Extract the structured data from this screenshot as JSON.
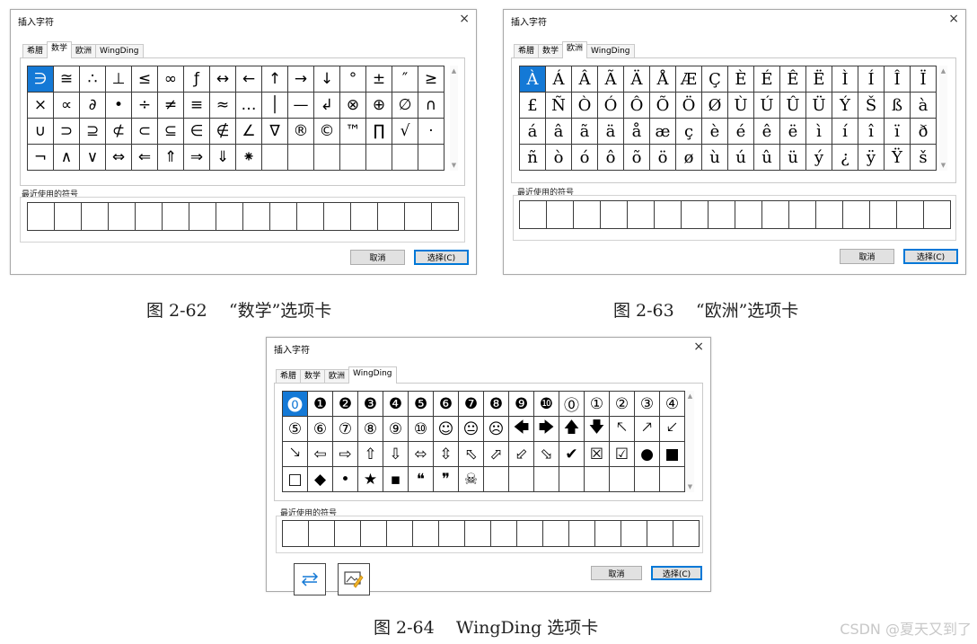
{
  "dialog_title": "插入字符",
  "close_glyph": "×",
  "tabs": [
    "希腊",
    "数学",
    "欧洲",
    "WingDing"
  ],
  "recent_label": "最近使用的符号",
  "cancel_label": "取消",
  "select_label": "选择(C)",
  "math_symbols": [
    "∋",
    "≅",
    "∴",
    "⊥",
    "≤",
    "∞",
    "ƒ",
    "↔",
    "←",
    "↑",
    "→",
    "↓",
    "°",
    "±",
    "″",
    "≥",
    "×",
    "∝",
    "∂",
    "•",
    "÷",
    "≠",
    "≡",
    "≈",
    "…",
    "│",
    "—",
    "↲",
    "⊗",
    "⊕",
    "∅",
    "∩",
    "∪",
    "⊃",
    "⊇",
    "⊄",
    "⊂",
    "⊆",
    "∈",
    "∉",
    "∠",
    "∇",
    "®",
    "©",
    "™",
    "∏",
    "√",
    "·",
    "¬",
    "∧",
    "∨",
    "⇔",
    "⇐",
    "⇑",
    "⇒",
    "⇓",
    "⁕",
    "",
    "",
    "",
    "",
    "",
    "",
    ""
  ],
  "euro_symbols": [
    "À",
    "Á",
    "Â",
    "Ã",
    "Ä",
    "Å",
    "Æ",
    "Ç",
    "È",
    "É",
    "Ê",
    "Ë",
    "Ì",
    "Í",
    "Î",
    "Ï",
    "£",
    "Ñ",
    "Ò",
    "Ó",
    "Ô",
    "Õ",
    "Ö",
    "Ø",
    "Ù",
    "Ú",
    "Û",
    "Ü",
    "Ý",
    "Š",
    "ß",
    "à",
    "á",
    "â",
    "ã",
    "ä",
    "å",
    "æ",
    "ç",
    "è",
    "é",
    "ê",
    "ë",
    "ì",
    "í",
    "î",
    "ï",
    "ð",
    "ñ",
    "ò",
    "ó",
    "ô",
    "õ",
    "ö",
    "ø",
    "ù",
    "ú",
    "û",
    "ü",
    "ý",
    "¿",
    "ÿ",
    "Ÿ",
    "š"
  ],
  "wing_symbols": [
    "⓿",
    "❶",
    "❷",
    "❸",
    "❹",
    "❺",
    "❻",
    "❼",
    "❽",
    "❾",
    "❿",
    "⓪",
    "①",
    "②",
    "③",
    "④",
    "⑤",
    "⑥",
    "⑦",
    "⑧",
    "⑨",
    "⑩",
    "☺",
    "😐",
    "☹",
    "🡄",
    "🡆",
    "🡅",
    "🡇",
    "🡔",
    "🡕",
    "🡗",
    "🡖",
    "⇦",
    "⇨",
    "⇧",
    "⇩",
    "⬄",
    "⇳",
    "⬁",
    "⬀",
    "⬃",
    "⬂",
    "✔",
    "☒",
    "☑",
    "●",
    "■",
    "□",
    "◆",
    "•",
    "★",
    "▪",
    "❝",
    "❞",
    "☠",
    "",
    "",
    "",
    "",
    "",
    "",
    "",
    ""
  ],
  "captions": {
    "fig62": "图 2-62    “数学”选项卡",
    "fig63": "图 2-63    “欧洲”选项卡",
    "fig64": "图 2-64    WingDing 选项卡"
  },
  "watermark": "CSDN @夏天又到了",
  "bottom_icons": [
    "swap-arrows-icon",
    "image-edit-icon"
  ],
  "colors": {
    "selected": "#1479d6",
    "primary_border": "#0078d7"
  }
}
